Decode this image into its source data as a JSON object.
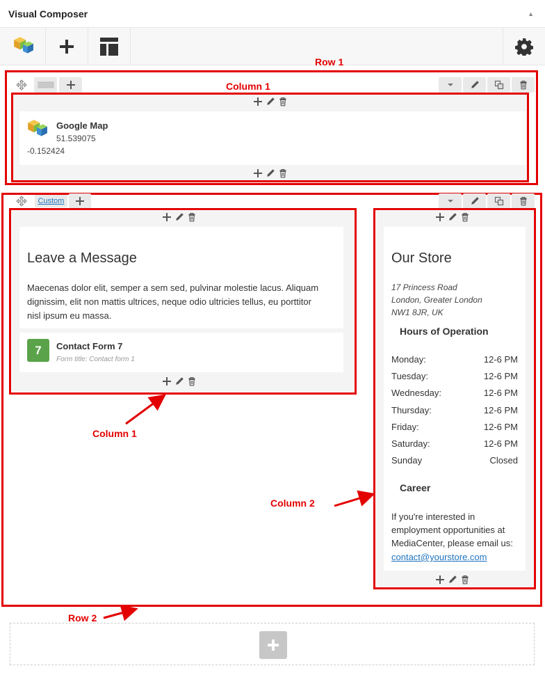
{
  "panel_title": "Visual Composer",
  "annotations": {
    "row1": "Row 1",
    "row2": "Row 2",
    "row1_column1": "Column 1",
    "row2_column1": "Column 1",
    "row2_column2": "Column 2"
  },
  "row2": {
    "layout_label": "Custom"
  },
  "google_map": {
    "title": "Google Map",
    "line1": "51.539075",
    "line2": "-0.152424"
  },
  "message": {
    "heading": "Leave a Message",
    "body_lines": [
      "Maecenas dolor elit, semper a sem sed, pulvinar molestie lacus. Aliquam",
      "dignissim, elit non mattis ultrices, neque odio ultricies tellus, eu porttitor",
      "nisl ipsum eu massa."
    ]
  },
  "contact_form": {
    "badge": "7",
    "title": "Contact Form 7",
    "subtitle": "Form title: Contact form 1"
  },
  "store": {
    "heading": "Our Store",
    "address_lines": [
      "17 Princess Road",
      "London, Greater London",
      "NW1 8JR, UK"
    ],
    "hours_heading": "Hours of Operation",
    "hours": [
      {
        "day": "Monday:",
        "time": "12-6 PM"
      },
      {
        "day": "Tuesday:",
        "time": "12-6 PM"
      },
      {
        "day": "Wednesday:",
        "time": "12-6 PM"
      },
      {
        "day": "Thursday:",
        "time": "12-6 PM"
      },
      {
        "day": "Friday:",
        "time": "12-6 PM"
      },
      {
        "day": "Saturday:",
        "time": "12-6 PM"
      },
      {
        "day": "Sunday",
        "time": "Closed"
      }
    ],
    "career_heading": "Career",
    "career_lines": [
      "If you're interested in",
      "employment opportunities at",
      "MediaCenter, please email us:"
    ],
    "email": "contact@yourstore.com"
  },
  "colors": {
    "annotation_red": "#e30000",
    "badge_green": "#5ba34a",
    "link_blue": "#1e73be"
  },
  "icons": [
    "vc-logo-icon",
    "plus-icon",
    "layout-icon",
    "gear-icon",
    "move-icon",
    "row-layout-icon",
    "chevron-down-icon",
    "pencil-icon",
    "clone-icon",
    "trash-icon",
    "caret-up-icon"
  ]
}
